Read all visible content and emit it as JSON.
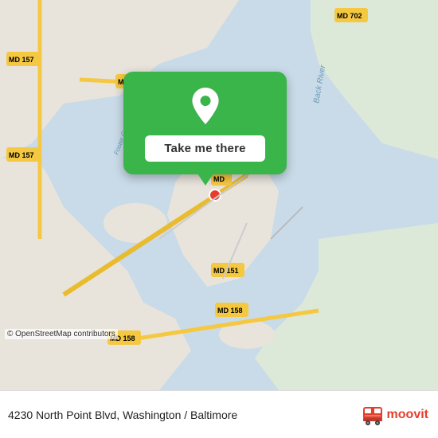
{
  "map": {
    "osm_credit": "© OpenStreetMap contributors"
  },
  "popup": {
    "button_label": "Take me there",
    "location_icon": "map-pin"
  },
  "bottom_bar": {
    "address": "4230 North Point Blvd, Washington / Baltimore",
    "brand": "moovit"
  }
}
